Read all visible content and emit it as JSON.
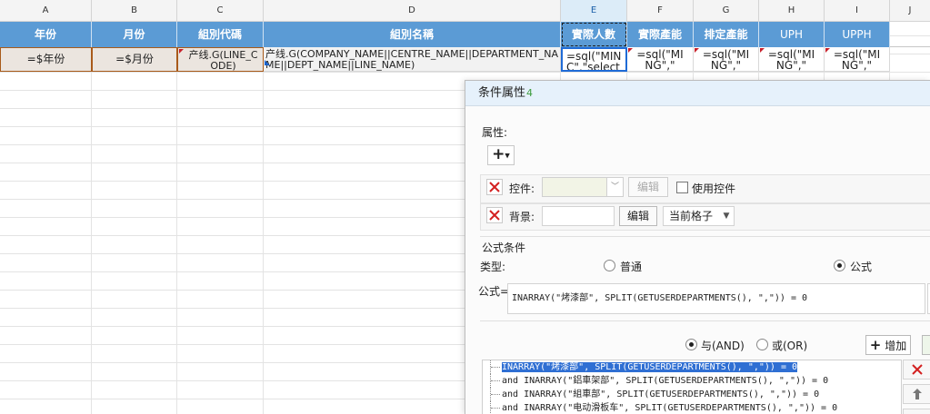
{
  "sheet": {
    "columns": [
      "A",
      "B",
      "C",
      "D",
      "E",
      "F",
      "G",
      "H",
      "I",
      "J"
    ],
    "header_row": [
      "年份",
      "月份",
      "組別代碼",
      "組別名稱",
      "實際人數",
      "實際產能",
      "排定產能",
      "UPH",
      "UPPH"
    ],
    "data_row": {
      "a": "=$年份",
      "b": "=$月份",
      "c": "产线.G(LINE_CODE)",
      "d": "产线.G(COMPANY_NAME||CENTRE_NAME||DEPARTMENT_NAME||DEPT_NAME||LINE_NAME)",
      "e": "=sql(\"MINC\",\"select",
      "f": "=sql(\"MING\",\"",
      "g": "=sql(\"MING\",\"",
      "h": "=sql(\"MING\",\"",
      "i": "=sql(\"MING\",\""
    },
    "accent": "#5b9bd5"
  },
  "dialog": {
    "title": "条件属性",
    "title_suffix": "4",
    "attr_label": "属性:",
    "add_symbol": "+",
    "control_label": "控件:",
    "control_select_value": "",
    "edit_label": "编辑",
    "use_control_label": "使用控件",
    "background_label": "背景:",
    "bg_edit_label": "编辑",
    "bg_scope_value": "当前格子",
    "formula_section": "公式条件",
    "type_label": "类型:",
    "type_options": [
      "普通",
      "公式"
    ],
    "type_selected": "公式",
    "formula_label": "公式=",
    "formula_value": "INARRAY(\"烤漆部\", SPLIT(GETUSERDEPARTMENTS(), \",\")) = 0",
    "logic_options": [
      "与(AND)",
      "或(OR)"
    ],
    "logic_selected": "与(AND)",
    "add_button": "增加",
    "conditions": [
      "INARRAY(\"烤漆部\", SPLIT(GETUSERDEPARTMENTS(), \",\")) = 0",
      "and INARRAY(\"鋁車架部\", SPLIT(GETUSERDEPARTMENTS(), \",\")) = 0",
      "and INARRAY(\"組車部\", SPLIT(GETUSERDEPARTMENTS(), \",\")) = 0",
      "and INARRAY(\"电动滑板车\", SPLIT(GETUSERDEPARTMENTS(), \",\")) = 0"
    ]
  }
}
